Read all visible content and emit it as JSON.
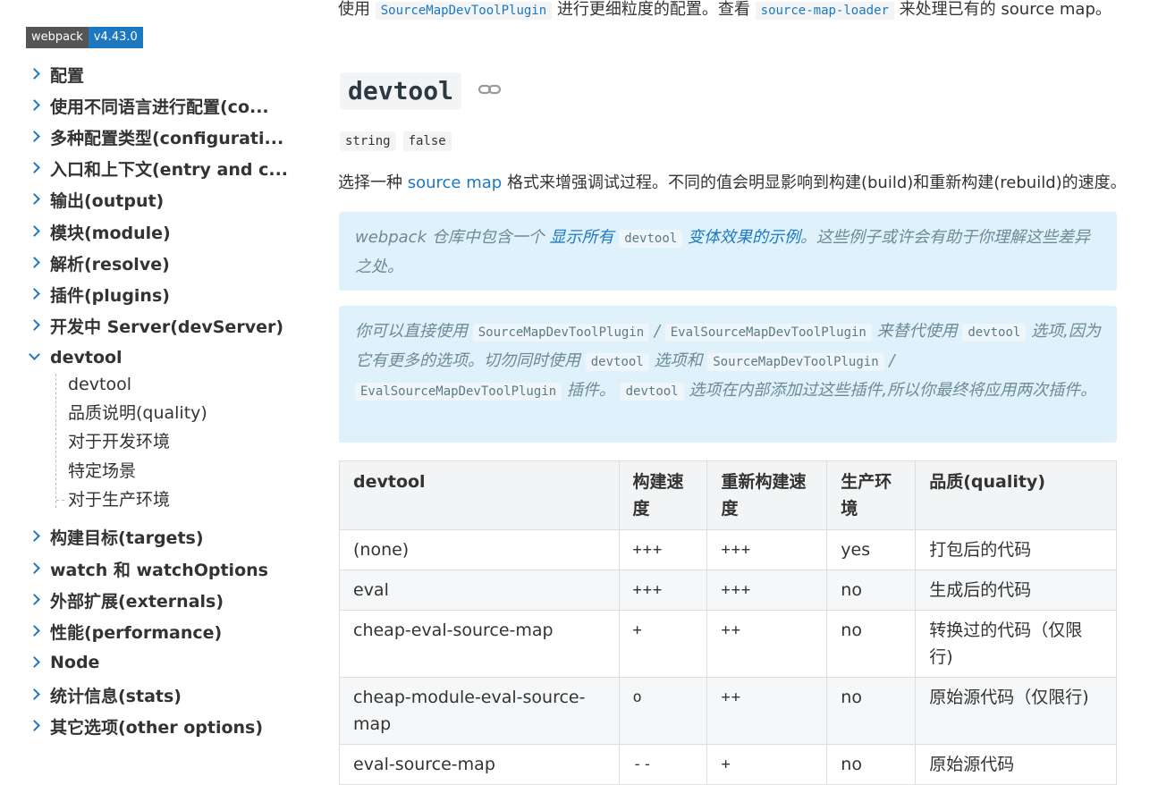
{
  "sidebar": {
    "badge": {
      "name": "webpack",
      "version": "v4.43.0"
    },
    "items": [
      {
        "label": "配置"
      },
      {
        "label": "使用不同语言进行配置(co..."
      },
      {
        "label": "多种配置类型(configurati..."
      },
      {
        "label": "入口和上下文(entry and c..."
      },
      {
        "label": "输出(output)"
      },
      {
        "label": "模块(module)"
      },
      {
        "label": "解析(resolve)"
      },
      {
        "label": "插件(plugins)"
      },
      {
        "label": "开发中 Server(devServer)"
      },
      {
        "label": "devtool"
      },
      {
        "label": "构建目标(targets)"
      },
      {
        "label": "watch 和 watchOptions"
      },
      {
        "label": "外部扩展(externals)"
      },
      {
        "label": "性能(performance)"
      },
      {
        "label": "Node"
      },
      {
        "label": "统计信息(stats)"
      },
      {
        "label": "其它选项(other options)"
      }
    ],
    "sub_items": [
      {
        "label": "devtool"
      },
      {
        "label": "品质说明(quality)"
      },
      {
        "label": "对于开发环境"
      },
      {
        "label": "特定场景"
      },
      {
        "label": "对于生产环境"
      }
    ]
  },
  "main": {
    "top": {
      "before": "使用",
      "code1": "SourceMapDevToolPlugin",
      "middle": "进行更细粒度的配置。查看",
      "code2": "source-map-loader",
      "after": "来处理已有的 source map。"
    },
    "heading": "devtool",
    "types": [
      "string",
      "false"
    ],
    "desc": {
      "before": "选择一种",
      "link": "source map",
      "after": "格式来增强调试过程。不同的值会明显影响到构建(build)和重新构建(rebuild)的速度。"
    },
    "tip1": {
      "before": "webpack 仓库中包含一个",
      "link1": "显示所有",
      "code": "devtool",
      "link2": "变体效果的示例",
      "after": "。这些例子或许会有助于你理解这些差异之处。"
    },
    "tip2": {
      "t1": "你可以直接使用",
      "c1": "SourceMapDevToolPlugin",
      "t2": "/",
      "c2": "EvalSourceMapDevToolPlugin",
      "t3": "来替代使用",
      "c3": "devtool",
      "t4": "选项,因为它有更多的选项。切勿同时使用",
      "c4": "devtool",
      "t5": "选项和",
      "c5": "SourceMapDevToolPlugin",
      "t6": "/",
      "c6": "EvalSourceMapDevToolPlugin",
      "t7": "插件。",
      "c7": "devtool",
      "t8": "选项在内部添加过这些插件,所以你最终将应用两次插件。"
    },
    "table": {
      "headers": [
        "devtool",
        "构建速度",
        "重新构建速度",
        "生产环境",
        "品质(quality)"
      ],
      "rows": [
        [
          "(none)",
          "+++",
          "+++",
          "yes",
          "打包后的代码"
        ],
        [
          "eval",
          "+++",
          "+++",
          "no",
          "生成后的代码"
        ],
        [
          "cheap-eval-source-map",
          "+",
          "++",
          "no",
          "转换过的代码（仅限行)"
        ],
        [
          "cheap-module-eval-source-map",
          "o",
          "++",
          "no",
          "原始源代码（仅限行)"
        ],
        [
          "eval-source-map",
          "--",
          "+",
          "no",
          "原始源代码"
        ]
      ]
    }
  },
  "colors": {
    "accent": "#1d78c1",
    "tip_bg": "#dff2fb",
    "code_bg": "#f2f4f5"
  }
}
